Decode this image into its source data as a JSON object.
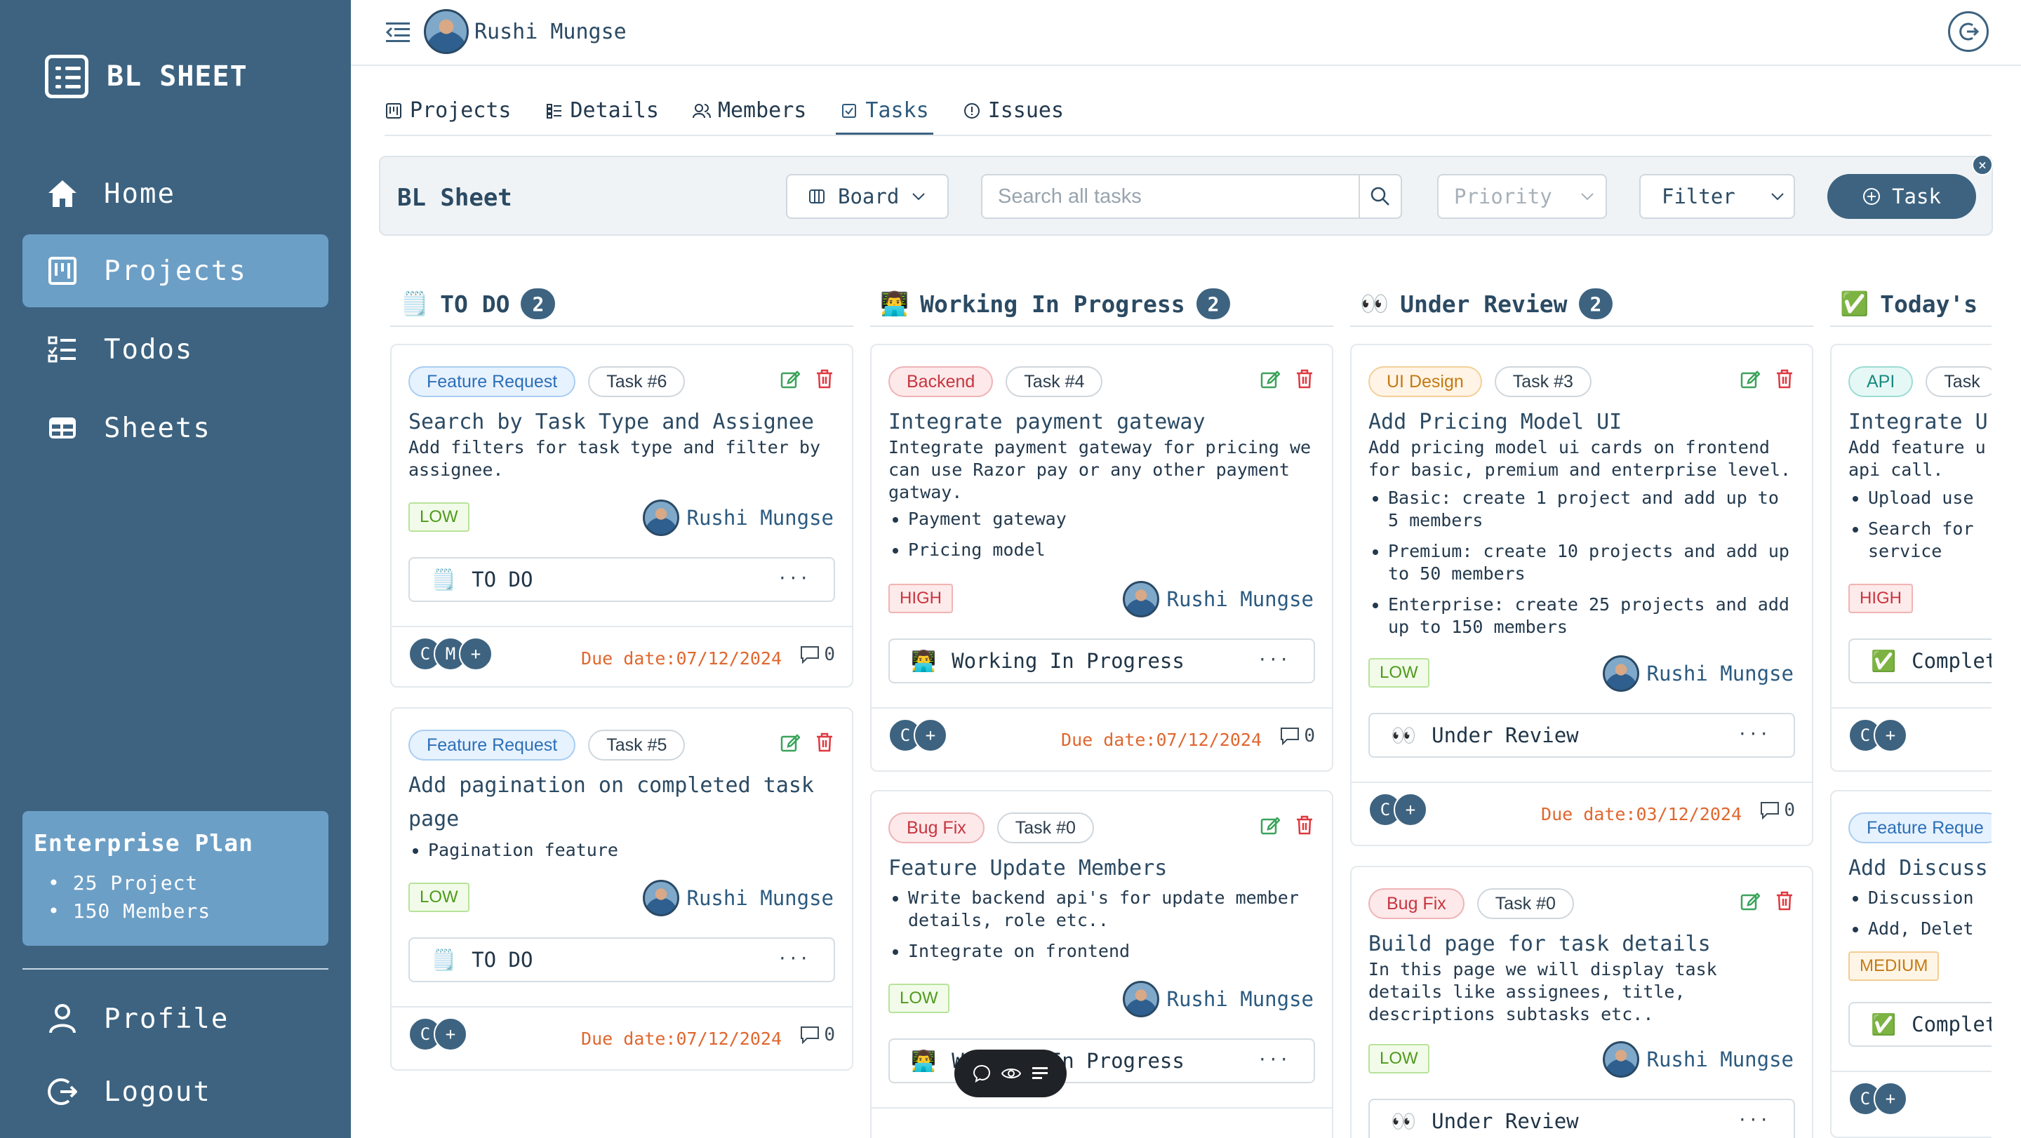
{
  "app": {
    "brand": "BL SHEET"
  },
  "sidebar": {
    "items": [
      {
        "label": "Home",
        "icon": "home-icon"
      },
      {
        "label": "Projects",
        "icon": "board-icon",
        "active": true
      },
      {
        "label": "Todos",
        "icon": "checklist-icon"
      },
      {
        "label": "Sheets",
        "icon": "table-icon"
      }
    ],
    "plan": {
      "title": "Enterprise Plan",
      "features": [
        "25 Project",
        "150 Members"
      ]
    },
    "bottom": [
      {
        "label": "Profile",
        "icon": "user-icon"
      },
      {
        "label": "Logout",
        "icon": "logout-icon"
      }
    ]
  },
  "topbar": {
    "user_name": "Rushi Mungse"
  },
  "tabs": [
    {
      "label": "Projects",
      "icon": "board-icon"
    },
    {
      "label": "Details",
      "icon": "details-icon"
    },
    {
      "label": "Members",
      "icon": "members-icon"
    },
    {
      "label": "Tasks",
      "icon": "tasks-icon",
      "active": true
    },
    {
      "label": "Issues",
      "icon": "issues-icon"
    }
  ],
  "toolbar": {
    "title": "BL Sheet",
    "view": "Board",
    "search_placeholder": "Search all tasks",
    "priority": "Priority",
    "filter": "Filter",
    "add_task": "Task",
    "close": "×"
  },
  "columns": [
    {
      "emoji": "🗒️",
      "title": "TO DO",
      "count": "2"
    },
    {
      "emoji": "👨‍💻",
      "title": "Working In Progress",
      "count": "2"
    },
    {
      "emoji": "👀",
      "title": "Under Review",
      "count": "2"
    },
    {
      "emoji": "✅",
      "title": "Today's",
      "count": ""
    }
  ],
  "cards": {
    "c1": {
      "tag": "Feature Request",
      "task": "Task #6",
      "title": "Search by Task Type and Assignee",
      "desc": "Add filters for task type and filter by assignee.",
      "priority": "LOW",
      "assignee": "Rushi Mungse",
      "status_emoji": "🗒️",
      "status": "TO DO",
      "members": [
        "C",
        "M",
        "+"
      ],
      "due": "Due date:07/12/2024",
      "comments": "0"
    },
    "c2": {
      "tag": "Feature Request",
      "task": "Task #5",
      "title": "Add pagination on completed task page",
      "list": [
        "Pagination feature"
      ],
      "priority": "LOW",
      "assignee": "Rushi Mungse",
      "status_emoji": "🗒️",
      "status": "TO DO",
      "members": [
        "C",
        "+"
      ],
      "due": "Due date:07/12/2024",
      "comments": "0"
    },
    "c3": {
      "tag": "Backend",
      "task": "Task #4",
      "title": "Integrate payment gateway",
      "desc": "Integrate payment gateway for pricing we can use Razor pay or any other payment gatway.",
      "list": [
        "Payment gateway",
        "Pricing model"
      ],
      "priority": "HIGH",
      "assignee": "Rushi Mungse",
      "status_emoji": "👨‍💻",
      "status": "Working In Progress",
      "members": [
        "C",
        "+"
      ],
      "due": "Due date:07/12/2024",
      "comments": "0"
    },
    "c4": {
      "tag": "Bug Fix",
      "task": "Task #0",
      "title": "Feature Update Members",
      "list": [
        "Write backend api's for update member details, role etc..",
        "Integrate on frontend"
      ],
      "priority": "LOW",
      "assignee": "Rushi Mungse",
      "status_emoji": "👨‍💻",
      "status": "Working In Progress"
    },
    "c5": {
      "tag": "UI Design",
      "task": "Task #3",
      "title": "Add Pricing Model UI",
      "desc": "Add pricing model ui cards on frontend for basic, premium and enterprise level.",
      "list": [
        "Basic: create 1 project and add up to 5 members",
        "Premium: create 10 projects and add up to 50 members",
        "Enterprise: create 25 projects and add up to 150 members"
      ],
      "priority": "LOW",
      "assignee": "Rushi Mungse",
      "status_emoji": "👀",
      "status": "Under Review",
      "members": [
        "C",
        "+"
      ],
      "due": "Due date:03/12/2024",
      "comments": "0"
    },
    "c6": {
      "tag": "Bug Fix",
      "task": "Task #0",
      "title": "Build page for task details",
      "desc": "In this page we will display task details like assignees, title, descriptions subtasks etc..",
      "priority": "LOW",
      "assignee": "Rushi Mungse",
      "status_emoji": "👀",
      "status": "Under Review"
    },
    "c7": {
      "tag": "API",
      "task": "Task",
      "title": "Integrate U",
      "desc": "Add feature u api call.",
      "list": [
        "Upload use",
        "Search for service"
      ],
      "priority": "HIGH",
      "status_emoji": "✅",
      "status": "Complet",
      "members": [
        "C",
        "+"
      ]
    },
    "c8": {
      "tag": "Feature Reque",
      "title": "Add Discuss",
      "list": [
        "Discussion",
        "Add, Delet"
      ],
      "priority": "MEDIUM",
      "status_emoji": "✅",
      "status": "Complet",
      "members": [
        "C",
        "+"
      ]
    }
  }
}
